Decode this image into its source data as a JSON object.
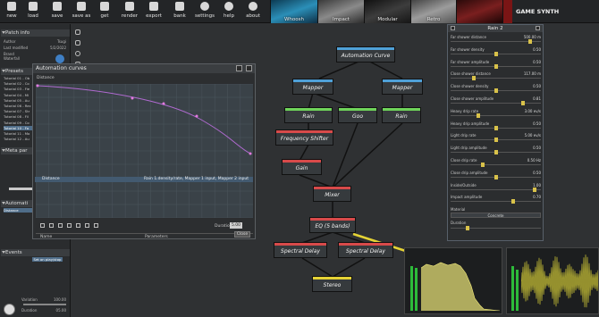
{
  "toolbar": {
    "buttons": [
      {
        "label": "new",
        "icon": "new-icon"
      },
      {
        "label": "load",
        "icon": "folder-icon"
      },
      {
        "label": "save",
        "icon": "save-icon"
      },
      {
        "label": "save as",
        "icon": "save-as-icon"
      },
      {
        "label": "get",
        "icon": "download-icon"
      },
      {
        "label": "render",
        "icon": "render-icon"
      },
      {
        "label": "export",
        "icon": "export-icon"
      },
      {
        "label": "bank",
        "icon": "bank-icon"
      },
      {
        "label": "settings",
        "icon": "gear-icon"
      },
      {
        "label": "help",
        "icon": "help-icon"
      },
      {
        "label": "about",
        "icon": "info-icon"
      }
    ],
    "presets": [
      "Whoosh",
      "Impact",
      "Modular",
      "Retro",
      ""
    ],
    "brand": "GAME SYNTH"
  },
  "left_panel": {
    "patch_info": {
      "header": "Patch info",
      "rows": [
        {
          "k": "Author",
          "v": "Tsugi"
        },
        {
          "k": "Last modified",
          "v": "5/2/2022"
        },
        {
          "k": "Brand",
          "v": ""
        },
        {
          "k": "Waterfall",
          "v": ""
        }
      ]
    },
    "presets": {
      "header": "Presets",
      "items": [
        "Tutorial 01 - Ob",
        "Tutorial 02 - Co",
        "Tutorial 03 - Fie",
        "Tutorial 04 - Mi",
        "Tutorial 05 - Au",
        "Tutorial 06 - Rec",
        "Tutorial 07 - Str",
        "Tutorial 08 - Fil",
        "Tutorial 09 - Co",
        "Tutorial 10 - Fo",
        "Tutorial 11 - Mo",
        "Tutorial 12 - Au"
      ],
      "selected_index": 9
    },
    "meta": {
      "header": "Meta par"
    },
    "automation": {
      "header": "Automati",
      "item": "Distance"
    },
    "events": {
      "header": "Events",
      "item": "Set on play/stop"
    },
    "variation": {
      "label": "Variation",
      "value": "100.00"
    },
    "duration": {
      "label": "Duration",
      "value": "05.00"
    }
  },
  "automation_window": {
    "title": "Automation curves",
    "subtitle": "Distance",
    "duration_label": "Duration",
    "duration_value": "5.00",
    "table_headers": [
      "Name",
      "Parameters"
    ],
    "row": {
      "name": "Distance",
      "params": "Rain 1.density/rate, Mapper 1 input, Mapper 2 input"
    },
    "close_label": "Close"
  },
  "nodes": {
    "automation_curve": "Automation Curve",
    "mapper1": "Mapper",
    "mapper2": "Mapper",
    "rain1": "Rain",
    "goo": "Goo",
    "rain2": "Rain",
    "freq_shifter": "Frequency Shifter",
    "gain": "Gain",
    "mixer": "Mixer",
    "eq": "EQ (5 bands)",
    "spectral_delay1": "Spectral Delay",
    "spectral_delay2": "Spectral Delay",
    "stereo": "Stereo"
  },
  "rain_panel": {
    "title": "Rain 2",
    "params": [
      {
        "label": "Far shower distance",
        "value": "500.00 m",
        "pos": 0.9
      },
      {
        "label": "Far shower density",
        "value": "0.50",
        "pos": 0.5
      },
      {
        "label": "Far shower amplitude",
        "value": "0.50",
        "pos": 0.5
      },
      {
        "label": "Close shower distance",
        "value": "117.00 m",
        "pos": 0.25
      },
      {
        "label": "Close shower density",
        "value": "0.50",
        "pos": 0.5
      },
      {
        "label": "Close shower amplitude",
        "value": "0.81",
        "pos": 0.81
      },
      {
        "label": "Heavy drip rate",
        "value": "3.00 ev/s",
        "pos": 0.3
      },
      {
        "label": "Heavy drip amplitude",
        "value": "0.50",
        "pos": 0.5
      },
      {
        "label": "Light drip rate",
        "value": "5.00 ev/s",
        "pos": 0.5
      },
      {
        "label": "Light drip amplitude",
        "value": "0.50",
        "pos": 0.5
      },
      {
        "label": "Close drip rate",
        "value": "0.50 Hz",
        "pos": 0.35
      },
      {
        "label": "Close drip amplitude",
        "value": "0.50",
        "pos": 0.5
      },
      {
        "label": "Inside/Outside",
        "value": "1.00",
        "pos": 0.95
      },
      {
        "label": "Impact amplitude",
        "value": "0.70",
        "pos": 0.7
      }
    ],
    "material_label": "Material",
    "material_value": "Concrete",
    "duration_label": "Duration"
  },
  "colors": {
    "accent": "#4f6d89",
    "yellow": "#d9c24a",
    "green": "#2dbb3a"
  }
}
